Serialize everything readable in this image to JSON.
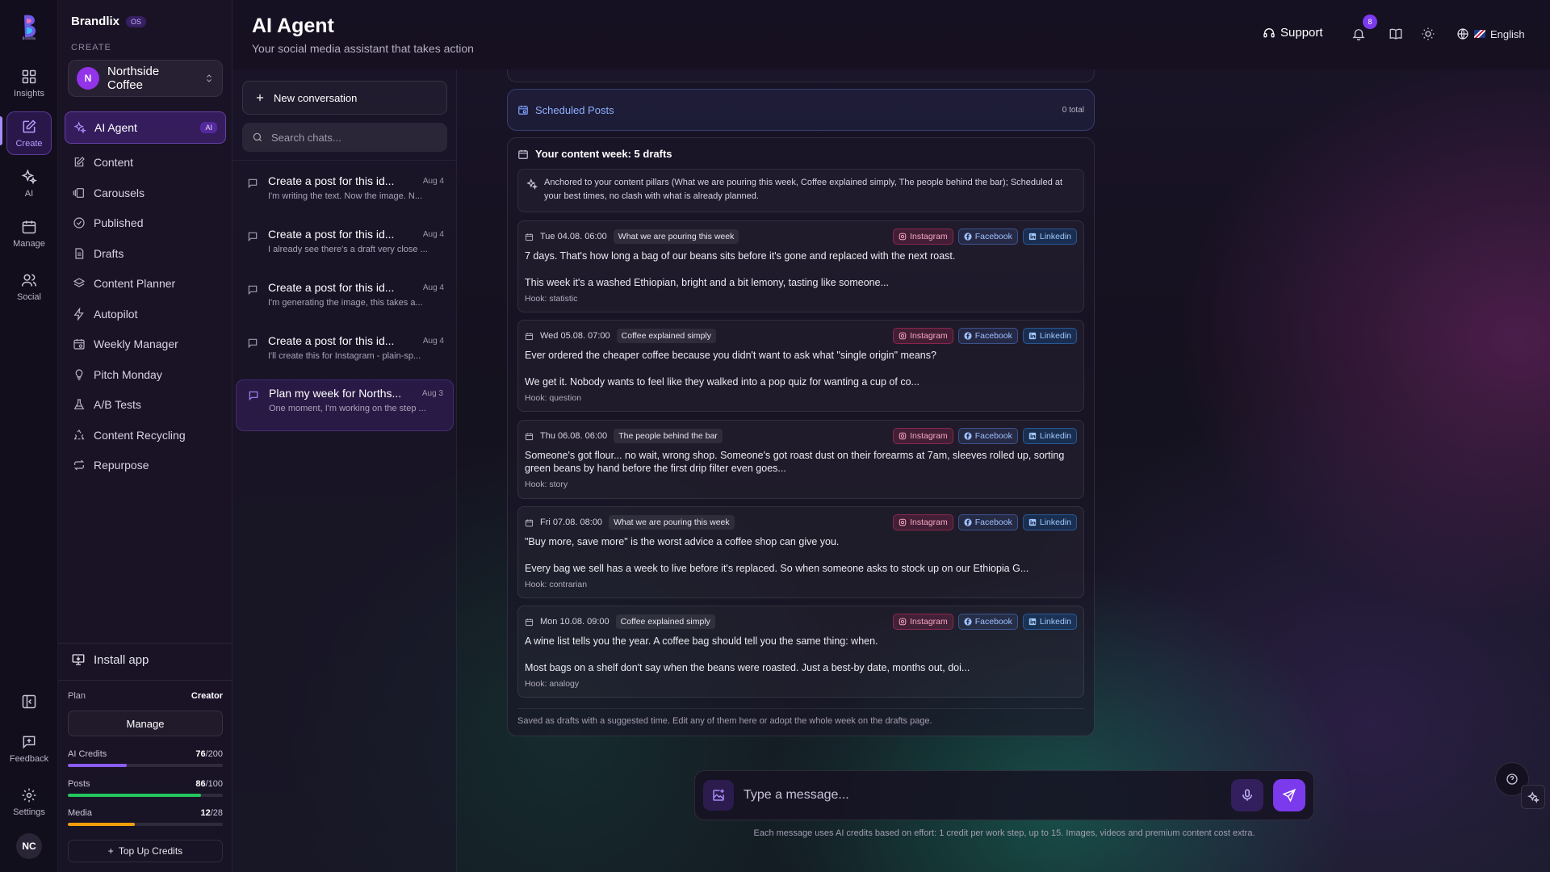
{
  "rail": {
    "logo_text": "Brandlix",
    "items": [
      {
        "label": "Insights",
        "icon": "grid-icon"
      },
      {
        "label": "Create",
        "icon": "edit-square-icon"
      },
      {
        "label": "AI",
        "icon": "sparkles-icon"
      },
      {
        "label": "Manage",
        "icon": "calendar-icon"
      },
      {
        "label": "Social",
        "icon": "users-icon"
      }
    ],
    "feedback_label": "Feedback",
    "settings_label": "Settings",
    "avatar_initials": "NC"
  },
  "nav": {
    "brand": "Brandlix",
    "brand_badge": "OS",
    "section_label": "CREATE",
    "workspace": {
      "initial": "N",
      "name": "Northside Coffee"
    },
    "items": [
      {
        "label": "AI Agent",
        "badge": "AI"
      },
      {
        "label": "Content"
      },
      {
        "label": "Carousels"
      },
      {
        "label": "Published"
      },
      {
        "label": "Drafts"
      },
      {
        "label": "Content Planner"
      },
      {
        "label": "Autopilot"
      },
      {
        "label": "Weekly Manager"
      },
      {
        "label": "Pitch Monday"
      },
      {
        "label": "A/B Tests"
      },
      {
        "label": "Content Recycling"
      },
      {
        "label": "Repurpose"
      }
    ],
    "install_label": "Install app",
    "plan_label": "Plan",
    "plan_value": "Creator",
    "manage_label": "Manage",
    "meters": [
      {
        "label": "AI Credits",
        "used": "76",
        "total": "/200",
        "fraction": 0.38,
        "color": "#8b5cf6"
      },
      {
        "label": "Posts",
        "used": "86",
        "total": "/100",
        "fraction": 0.86,
        "color": "#22c55e"
      },
      {
        "label": "Media",
        "used": "12",
        "total": "/28",
        "fraction": 0.43,
        "color": "#f59e0b"
      }
    ],
    "topup_label": "Top Up Credits"
  },
  "header": {
    "title": "AI Agent",
    "subtitle": "Your social media assistant that takes action",
    "support_label": "Support",
    "notifications_count": "8",
    "language": "English"
  },
  "chats": {
    "new_label": "New conversation",
    "search_placeholder": "Search chats...",
    "items": [
      {
        "title": "Create a post for this id...",
        "date": "Aug 4",
        "preview": "I'm writing the text. Now the image. N..."
      },
      {
        "title": "Create a post for this id...",
        "date": "Aug 4",
        "preview": "I already see there's a draft very close ..."
      },
      {
        "title": "Create a post for this id...",
        "date": "Aug 4",
        "preview": "I'm generating the image, this takes a..."
      },
      {
        "title": "Create a post for this id...",
        "date": "Aug 4",
        "preview": "I'll create this for Instagram - plain-sp..."
      },
      {
        "title": "Plan my week for Norths...",
        "date": "Aug 3",
        "preview": "One moment, I'm working on the step ..."
      }
    ]
  },
  "scheduled": {
    "title": "Scheduled Posts",
    "total": "0 total"
  },
  "week": {
    "title": "Your content week: 5 drafts",
    "anchor_text": "Anchored to your content pillars (What we are pouring this week, Coffee explained simply, The people behind the bar); Scheduled at your best times, no clash with what is already planned.",
    "platform_labels": {
      "instagram": "Instagram",
      "facebook": "Facebook",
      "linkedin": "Linkedin"
    },
    "drafts": [
      {
        "date": "Tue 04.08. 06:00",
        "pillar": "What we are pouring this week",
        "line1": "7 days. That's how long a bag of our beans sits before it's gone and replaced with the next roast.",
        "line2": "This week it's a washed Ethiopian, bright and a bit lemony, tasting like someone...",
        "hook": "Hook: statistic"
      },
      {
        "date": "Wed 05.08. 07:00",
        "pillar": "Coffee explained simply",
        "line1": "Ever ordered the cheaper coffee because you didn't want to ask what \"single origin\" means?",
        "line2": "We get it. Nobody wants to feel like they walked into a pop quiz for wanting a cup of co...",
        "hook": "Hook: question"
      },
      {
        "date": "Thu 06.08. 06:00",
        "pillar": "The people behind the bar",
        "line1": "Someone's got flour... no wait, wrong shop. Someone's got roast dust on their forearms at 7am, sleeves rolled up, sorting green beans by hand before the first drip filter even goes...",
        "line2": "",
        "hook": "Hook: story"
      },
      {
        "date": "Fri 07.08. 08:00",
        "pillar": "What we are pouring this week",
        "line1": "\"Buy more, save more\" is the worst advice a coffee shop can give you.",
        "line2": "Every bag we sell has a week to live before it's replaced. So when someone asks to stock up on our Ethiopia G...",
        "hook": "Hook: contrarian"
      },
      {
        "date": "Mon 10.08. 09:00",
        "pillar": "Coffee explained simply",
        "line1": "A wine list tells you the year. A coffee bag should tell you the same thing: when.",
        "line2": "Most bags on a shelf don't say when the beans were roasted. Just a best-by date, months out, doi...",
        "hook": "Hook: analogy"
      }
    ],
    "footer": "Saved as drafts with a suggested time. Edit any of them here or adopt the whole week on the drafts page."
  },
  "composer": {
    "placeholder": "Type a message...",
    "note": "Each message uses AI credits based on effort: 1 credit per work step, up to 15. Images, videos and premium content cost extra."
  }
}
